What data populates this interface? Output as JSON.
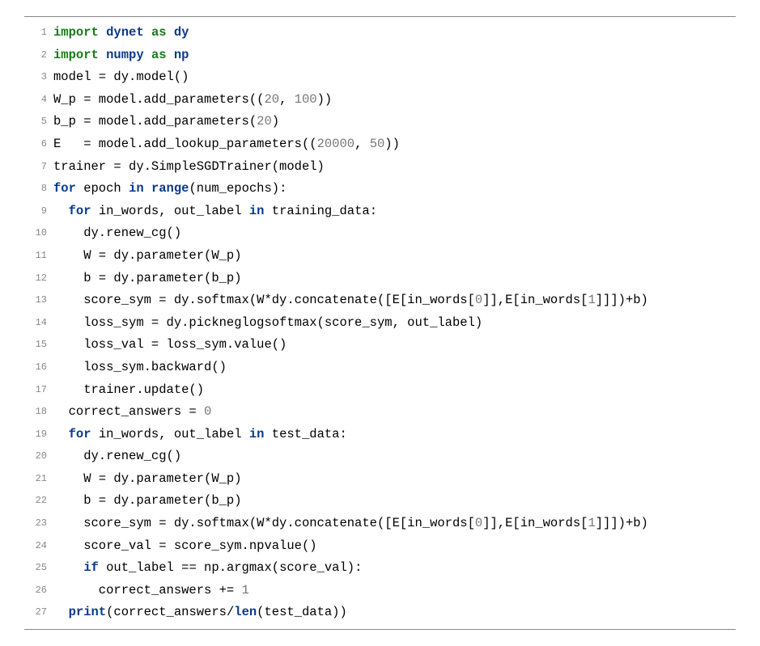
{
  "code": {
    "lines": [
      {
        "ln": "1",
        "html": "<span class='kw-import'>import</span> <span class='id'>dynet</span> <span class='kw-import'>as</span> <span class='id'>dy</span>"
      },
      {
        "ln": "2",
        "html": "<span class='kw-import'>import</span> <span class='id'>numpy</span> <span class='kw-import'>as</span> <span class='id'>np</span>"
      },
      {
        "ln": "3",
        "html": "model = dy.model()"
      },
      {
        "ln": "4",
        "html": "W_p = model.add_parameters((<span class='num'>20</span>, <span class='num'>100</span>))"
      },
      {
        "ln": "5",
        "html": "b_p = model.add_parameters(<span class='num'>20</span>)"
      },
      {
        "ln": "6",
        "html": "E   = model.add_lookup_parameters((<span class='num'>20000</span>, <span class='num'>50</span>))"
      },
      {
        "ln": "7",
        "html": "trainer = dy.SimpleSGDTrainer(model)"
      },
      {
        "ln": "8",
        "html": "<span class='kw-ctrl'>for</span> epoch <span class='kw-ctrl'>in</span> <span class='kw-ctrl'>range</span>(num_epochs):"
      },
      {
        "ln": "9",
        "html": "  <span class='kw-ctrl'>for</span> in_words, out_label <span class='kw-ctrl'>in</span> training_data:"
      },
      {
        "ln": "10",
        "html": "    dy.renew_cg()"
      },
      {
        "ln": "11",
        "html": "    W = dy.parameter(W_p)"
      },
      {
        "ln": "12",
        "html": "    b = dy.parameter(b_p)"
      },
      {
        "ln": "13",
        "html": "    score_sym = dy.softmax(W*dy.concatenate([E[in_words[<span class='num'>0</span>]],E[in_words[<span class='num'>1</span>]]])+b)"
      },
      {
        "ln": "14",
        "html": "    loss_sym = dy.pickneglogsoftmax(score_sym, out_label)"
      },
      {
        "ln": "15",
        "html": "    loss_val = loss_sym.value()"
      },
      {
        "ln": "16",
        "html": "    loss_sym.backward()"
      },
      {
        "ln": "17",
        "html": "    trainer.update()"
      },
      {
        "ln": "18",
        "html": "  correct_answers = <span class='num'>0</span>"
      },
      {
        "ln": "19",
        "html": "  <span class='kw-ctrl'>for</span> in_words, out_label <span class='kw-ctrl'>in</span> test_data:"
      },
      {
        "ln": "20",
        "html": "    dy.renew_cg()"
      },
      {
        "ln": "21",
        "html": "    W = dy.parameter(W_p)"
      },
      {
        "ln": "22",
        "html": "    b = dy.parameter(b_p)"
      },
      {
        "ln": "23",
        "html": "    score_sym = dy.softmax(W*dy.concatenate([E[in_words[<span class='num'>0</span>]],E[in_words[<span class='num'>1</span>]]])+b)"
      },
      {
        "ln": "24",
        "html": "    score_val = score_sym.npvalue()"
      },
      {
        "ln": "25",
        "html": "    <span class='kw-ctrl'>if</span> out_label == np.argmax(score_val):"
      },
      {
        "ln": "26",
        "html": "      correct_answers += <span class='num'>1</span>"
      },
      {
        "ln": "27",
        "html": "  <span class='kw-ctrl'>print</span>(correct_answers/<span class='kw-ctrl'>len</span>(test_data))"
      }
    ]
  }
}
